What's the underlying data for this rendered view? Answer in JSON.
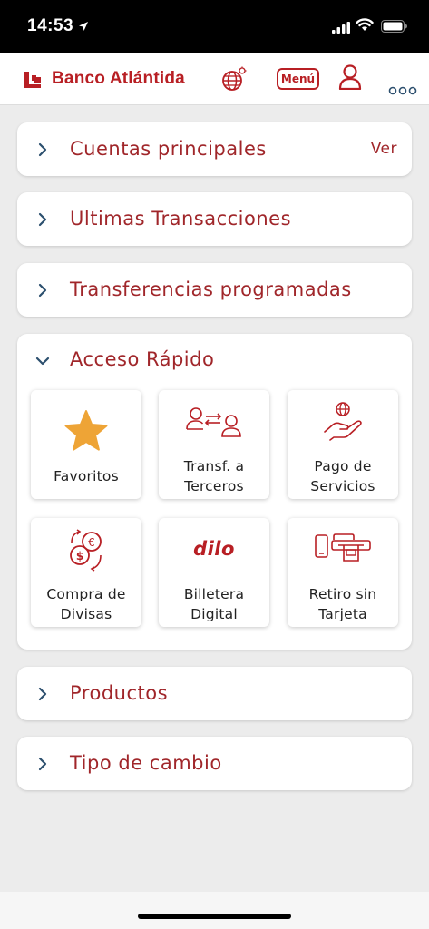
{
  "status_bar": {
    "time": "14:53"
  },
  "header": {
    "brand": "Banco Atlántida",
    "menu_label": "Menú"
  },
  "colors": {
    "brand_red": "#b81f24",
    "title_red": "#a0262a",
    "chevron_blue": "#2c4f6e",
    "star_yellow": "#eea436"
  },
  "sections": {
    "cuentas": {
      "title": "Cuentas principales",
      "action": "Ver"
    },
    "transacciones": {
      "title": "Ultimas Transacciones"
    },
    "transferencias": {
      "title": "Transferencias programadas"
    },
    "acceso": {
      "title": "Acceso Rápido"
    },
    "productos": {
      "title": "Productos"
    },
    "cambio": {
      "title": "Tipo de cambio"
    }
  },
  "quick_access": [
    {
      "icon": "star-icon",
      "line1": "Favoritos",
      "line2": ""
    },
    {
      "icon": "transfer-people-icon",
      "line1": "Transf. a",
      "line2": "Terceros"
    },
    {
      "icon": "hand-globe-icon",
      "line1": "Pago de",
      "line2": "Servicios"
    },
    {
      "icon": "currency-exchange-icon",
      "line1": "Compra de",
      "line2": "Divisas"
    },
    {
      "icon": "dilo-logo",
      "line1": "Billetera",
      "line2": "Digital",
      "logo_text": "dilo"
    },
    {
      "icon": "cardless-withdrawal-icon",
      "line1": "Retiro sin",
      "line2": "Tarjeta"
    }
  ]
}
